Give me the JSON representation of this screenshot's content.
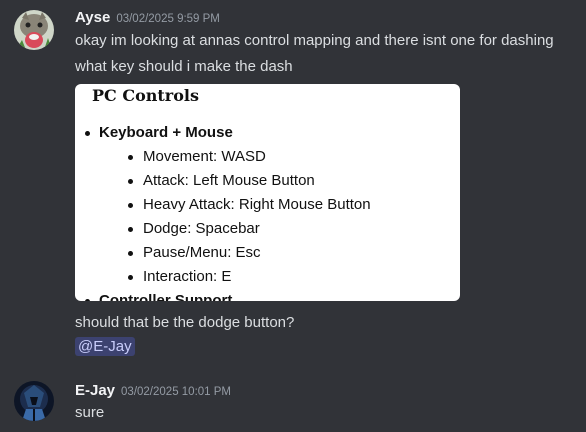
{
  "messages": [
    {
      "username": "Ayse",
      "timestamp": "03/02/2025 9:59 PM",
      "avatar_icon": "cat-avatar-icon",
      "lines": [
        "okay im looking at annas control mapping and there isnt one for dashing",
        "what key should i make the dash"
      ],
      "embed": {
        "title": "PC Controls",
        "sections": [
          {
            "heading": "Keyboard + Mouse",
            "items": [
              "Movement: WASD",
              "Attack: Left Mouse Button",
              "Heavy Attack: Right Mouse Button",
              "Dodge: Spacebar",
              "Pause/Menu: Esc",
              "Interaction: E"
            ]
          },
          {
            "heading": "Controller Support",
            "items": []
          }
        ]
      },
      "followup": "should that be the dodge button?",
      "mention": "@E-Jay"
    },
    {
      "username": "E-Jay",
      "timestamp": "03/02/2025 10:01 PM",
      "avatar_icon": "dark-character-avatar-icon",
      "lines": [
        "sure"
      ]
    }
  ],
  "colors": {
    "background": "#313338",
    "username": "#f2f3f5",
    "text": "#dbdee1",
    "timestamp": "#949ba4",
    "mention_bg": "#3c4270",
    "mention_text": "#c9cdfb"
  }
}
